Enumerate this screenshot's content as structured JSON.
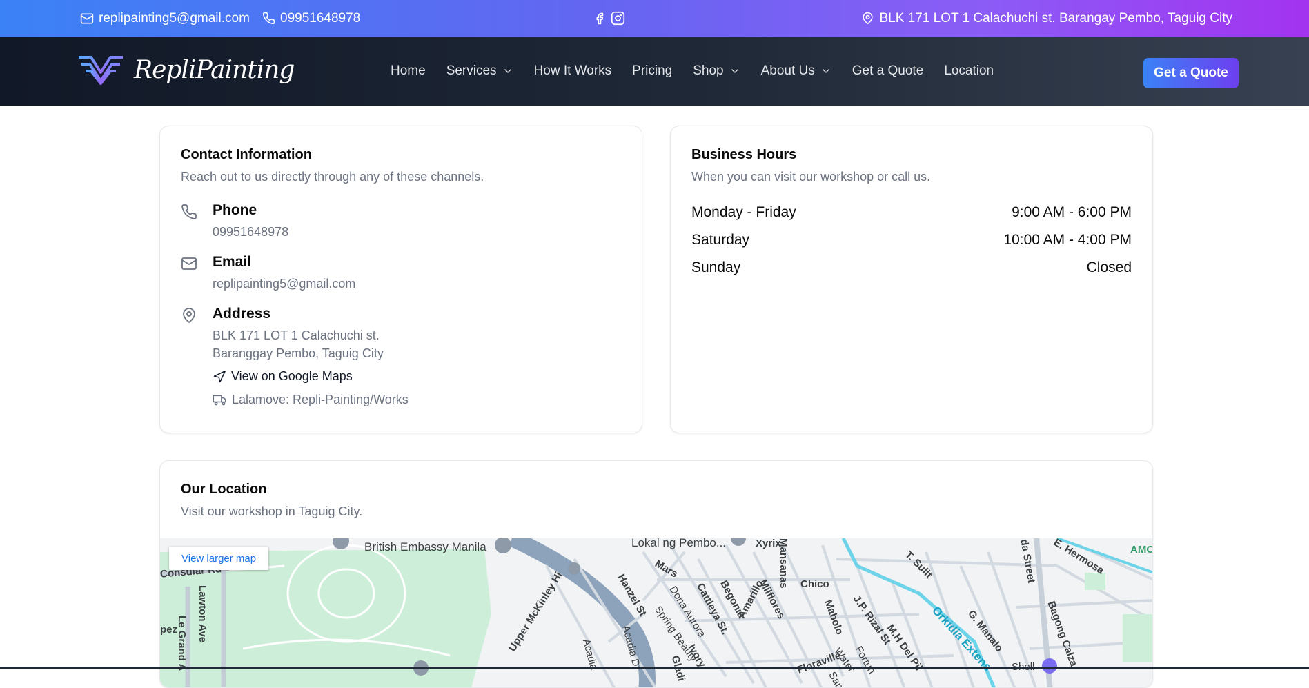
{
  "topbar": {
    "email": "replipainting5@gmail.com",
    "phone": "09951648978",
    "social": [
      "facebook-icon",
      "instagram-icon"
    ],
    "address": "BLK 171 LOT 1 Calachuchi st. Barangay Pembo, Taguig City"
  },
  "nav": {
    "brand": "RepliPainting",
    "links": [
      {
        "label": "Home"
      },
      {
        "label": "Services",
        "dropdown": true
      },
      {
        "label": "How It Works"
      },
      {
        "label": "Pricing"
      },
      {
        "label": "Shop",
        "dropdown": true
      },
      {
        "label": "About Us",
        "dropdown": true
      },
      {
        "label": "Get a Quote"
      },
      {
        "label": "Location"
      }
    ],
    "cta": "Get a Quote"
  },
  "contact": {
    "title": "Contact Information",
    "subtitle": "Reach out to us directly through any of these channels.",
    "phone_label": "Phone",
    "phone_value": "09951648978",
    "email_label": "Email",
    "email_value": "replipainting5@gmail.com",
    "address_label": "Address",
    "address_line1": "BLK 171 LOT 1 Calachuchi st.",
    "address_line2": "Baranggay Pembo, Taguig City",
    "maps_link": "View on Google Maps",
    "lalamove": "Lalamove: Repli-Painting/Works"
  },
  "hours": {
    "title": "Business Hours",
    "subtitle": "When you can visit our workshop or call us.",
    "rows": [
      {
        "day": "Monday - Friday",
        "time": "9:00 AM - 6:00 PM"
      },
      {
        "day": "Saturday",
        "time": "10:00 AM - 4:00 PM"
      },
      {
        "day": "Sunday",
        "time": "Closed"
      }
    ]
  },
  "location": {
    "title": "Our Location",
    "subtitle": "Visit our workshop in Taguig City.",
    "map_button": "View larger map",
    "map_labels": {
      "british_embassy": "British Embassy Manila",
      "lokal": "Lokal ng Pembo...",
      "xyrix": "Xyrix",
      "mansanas": "Mansanas",
      "chico": "Chico",
      "t_sulit": "T. Sulit",
      "e_hermosa": "E. Hermosa",
      "da_street": "da Street",
      "amc": "AMC",
      "consular": "Consular Rd",
      "lawton": "Lawton Ave",
      "le_grand": "Le Grand A",
      "pez": "pez",
      "upper_mckinley": "Upper McKinley Hi",
      "mars": "Mars",
      "hanzel": "Hanzel St",
      "dona_aurora": "Dona Aurora",
      "spring_beauty": "Spring Beauty",
      "cattleya": "Cattleya St.",
      "begonia": "Begonia",
      "amarillo": "Amarillo",
      "milflores": "Milflores",
      "mabolo": "Mabolo",
      "jp_rizal": "J.P. Rizal St",
      "mh_del_pilar": "M.H Del Pil",
      "orkidia": "Orkidia Extens",
      "g_manalo": "G. Manalo",
      "bagong_calzada": "Bagong Calza",
      "acadia": "Acadia Dr",
      "acadia2": "Acadia",
      "ivory": "Ivory",
      "gladi": "Gladi",
      "floraville": "Floraville",
      "water": "Water",
      "fortun": "Fortun",
      "san": "San",
      "shell": "Shell"
    }
  }
}
